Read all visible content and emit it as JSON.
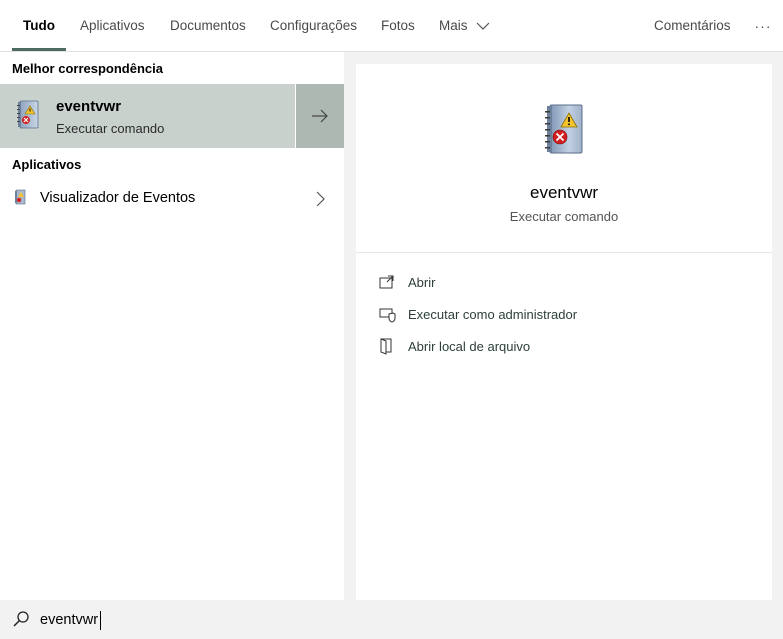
{
  "tabs": [
    {
      "label": "Tudo",
      "active": true
    },
    {
      "label": "Aplicativos"
    },
    {
      "label": "Documentos"
    },
    {
      "label": "Configurações"
    },
    {
      "label": "Fotos"
    },
    {
      "label": "Mais"
    }
  ],
  "top_right": {
    "comments": "Comentários",
    "more": "···"
  },
  "best_match": {
    "heading": "Melhor correspondência",
    "title": "eventvwr",
    "subtitle": "Executar comando",
    "icon": "event-viewer-icon",
    "arrow_icon": "arrow-right-icon"
  },
  "apps": {
    "heading": "Aplicativos",
    "items": [
      {
        "label": "Visualizador de Eventos",
        "icon": "event-viewer-icon"
      }
    ]
  },
  "preview": {
    "title": "eventvwr",
    "subtitle": "Executar comando",
    "actions": [
      {
        "label": "Abrir",
        "icon": "open-icon"
      },
      {
        "label": "Executar como administrador",
        "icon": "shield-icon"
      },
      {
        "label": "Abrir local de arquivo",
        "icon": "file-location-icon"
      }
    ]
  },
  "search": {
    "value": "eventvwr"
  },
  "colors": {
    "accent": "#4e6b62",
    "best_bg": "#c9d1cd",
    "arrow_bg": "#aeb8b3"
  }
}
